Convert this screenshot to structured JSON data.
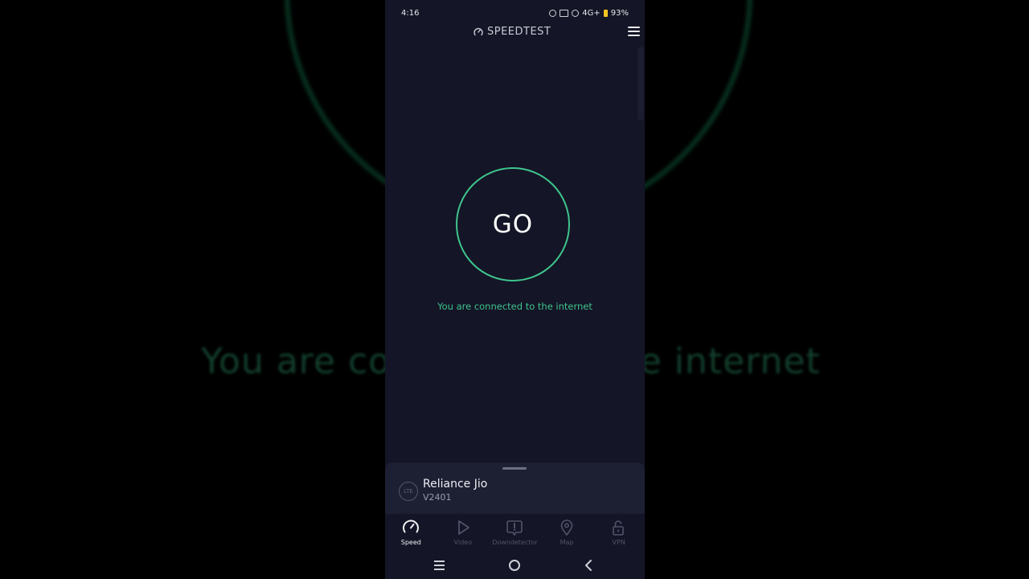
{
  "background": {
    "blurred_text": "You are connected to the internet"
  },
  "status_bar": {
    "time": "4:16",
    "network": "4G+",
    "battery": "93%"
  },
  "header": {
    "title": "SPEEDTEST"
  },
  "main": {
    "go_label": "GO",
    "connection_status": "You are connected to the internet",
    "accent_color": "#3ec48d"
  },
  "provider_sheet": {
    "badge": "LTE",
    "carrier": "Reliance Jio",
    "server": "V2401"
  },
  "tabs": [
    {
      "label": "Speed",
      "icon": "speed-gauge-icon",
      "active": true
    },
    {
      "label": "Video",
      "icon": "play-icon",
      "active": false
    },
    {
      "label": "Downdetector",
      "icon": "alert-icon",
      "active": false
    },
    {
      "label": "Map",
      "icon": "map-pin-icon",
      "active": false
    },
    {
      "label": "VPN",
      "icon": "lock-icon",
      "active": false
    }
  ]
}
